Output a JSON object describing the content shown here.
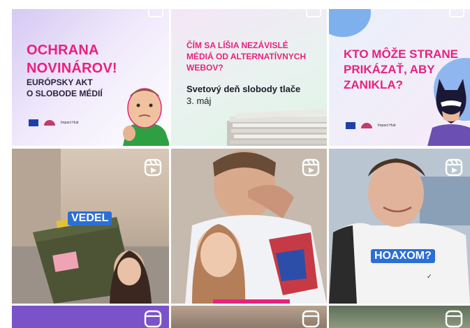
{
  "tiles": {
    "t11": {
      "headline": "OCHRANA NOVINÁROV!",
      "headline_lines": [
        "OCHRANA",
        "NOVINÁROV!"
      ],
      "sub_lines": [
        "EURÓPSKY AKT",
        "O SLOBODE MÉDIÍ"
      ],
      "footer_logo_text": "Impact Hub"
    },
    "t12": {
      "headline_lines": [
        "ČÍM SA LÍŠIA NEZÁVISLÉ",
        "MÉDIÁ OD ALTERNATÍVNYCH",
        "WEBOV?"
      ],
      "subtitle": "Svetový deň slobody tlače",
      "date": "3. máj"
    },
    "t13": {
      "headline_lines": [
        "KTO MÔŽE STRANE",
        "PRIKÁZAŤ, ABY",
        "ZANIKLA?"
      ],
      "footer_logo_text": "Impact Hub"
    },
    "t21": {
      "caption": "VEDEL"
    },
    "t23": {
      "caption": "HOAXOM?"
    }
  },
  "colors": {
    "brand_pink": "#e8217f",
    "caption_blue": "#2b6fd6",
    "caption_yellow": "#f3d43a"
  },
  "icons": {
    "multi_post": "carousel-icon",
    "reel": "reels-icon"
  }
}
